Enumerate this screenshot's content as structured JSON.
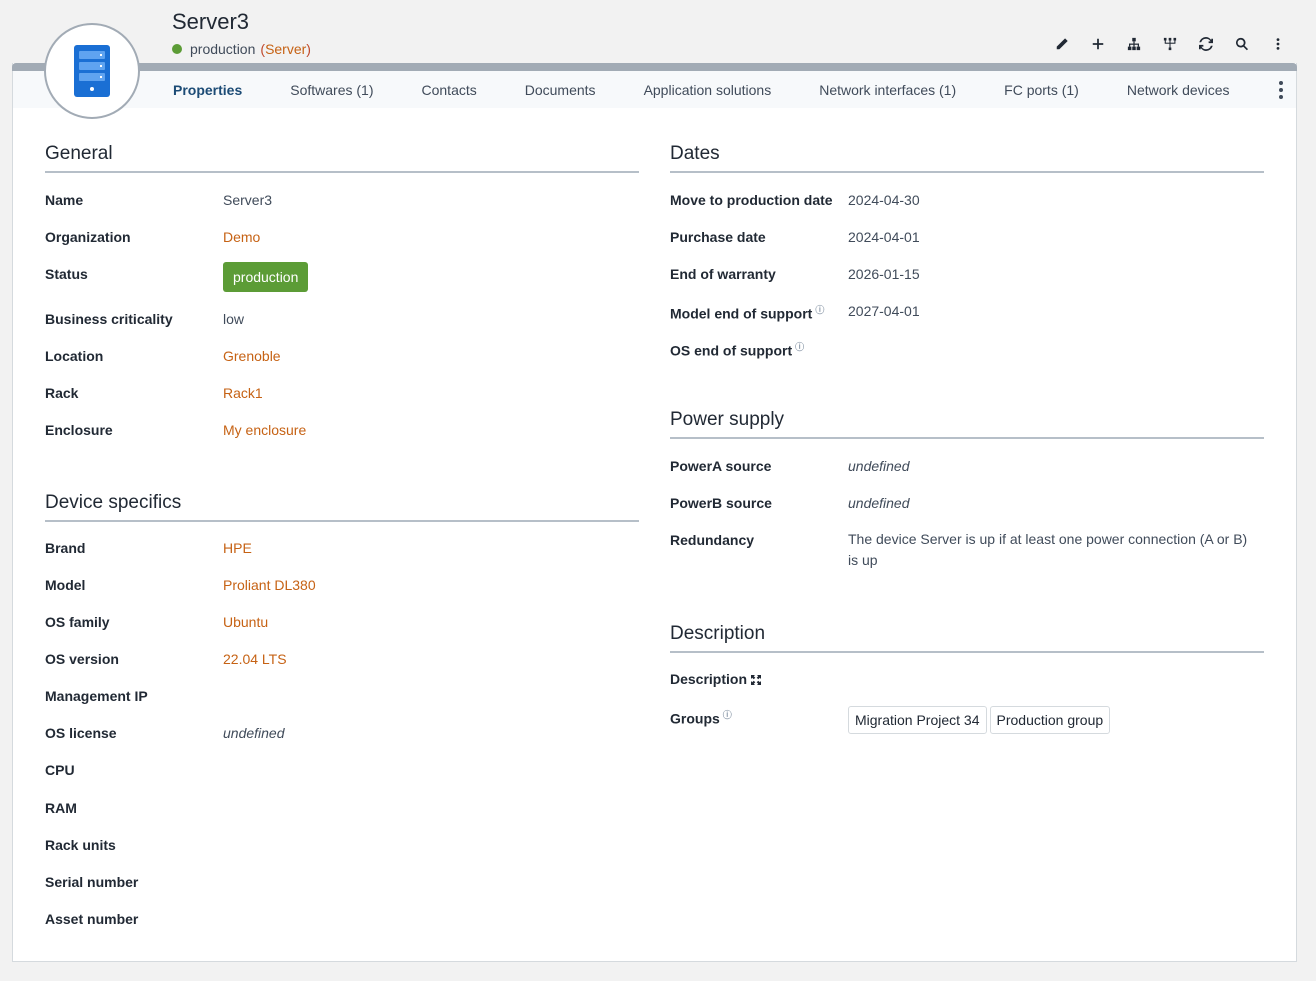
{
  "header": {
    "title": "Server3",
    "status": "production",
    "class_label": "Server",
    "toolbar": [
      "edit-icon",
      "add-icon",
      "hierarchy-icon",
      "network-icon",
      "refresh-icon",
      "search-icon",
      "more-icon"
    ]
  },
  "tabs": [
    {
      "label": "Properties",
      "active": true
    },
    {
      "label": "Softwares (1)"
    },
    {
      "label": "Contacts"
    },
    {
      "label": "Documents"
    },
    {
      "label": "Application solutions"
    },
    {
      "label": "Network interfaces (1)"
    },
    {
      "label": "FC ports (1)"
    },
    {
      "label": "Network devices"
    }
  ],
  "general": {
    "title": "General",
    "fields": {
      "name": {
        "label": "Name",
        "value": "Server3"
      },
      "organization": {
        "label": "Organization",
        "value": "Demo"
      },
      "status": {
        "label": "Status",
        "value": "production"
      },
      "business_criticality": {
        "label": "Business criticality",
        "value": "low"
      },
      "location": {
        "label": "Location",
        "value": "Grenoble"
      },
      "rack": {
        "label": "Rack",
        "value": "Rack1"
      },
      "enclosure": {
        "label": "Enclosure",
        "value": "My enclosure"
      }
    }
  },
  "device": {
    "title": "Device specifics",
    "fields": {
      "brand": {
        "label": "Brand",
        "value": "HPE"
      },
      "model": {
        "label": "Model",
        "value": "Proliant DL380"
      },
      "os_family": {
        "label": "OS family",
        "value": "Ubuntu"
      },
      "os_version": {
        "label": "OS version",
        "value": "22.04 LTS"
      },
      "management_ip": {
        "label": "Management IP",
        "value": ""
      },
      "os_license": {
        "label": "OS license",
        "value": "undefined"
      },
      "cpu": {
        "label": "CPU",
        "value": ""
      },
      "ram": {
        "label": "RAM",
        "value": ""
      },
      "rack_units": {
        "label": "Rack units",
        "value": ""
      },
      "serial_number": {
        "label": "Serial number",
        "value": ""
      },
      "asset_number": {
        "label": "Asset number",
        "value": ""
      }
    }
  },
  "dates": {
    "title": "Dates",
    "fields": {
      "move_to_production": {
        "label": "Move to production date",
        "value": "2024-04-30"
      },
      "purchase_date": {
        "label": "Purchase date",
        "value": "2024-04-01"
      },
      "end_of_warranty": {
        "label": "End of warranty",
        "value": "2026-01-15"
      },
      "model_end_of_support": {
        "label": "Model end of support",
        "value": "2027-04-01"
      },
      "os_end_of_support": {
        "label": "OS end of support",
        "value": ""
      }
    }
  },
  "power": {
    "title": "Power supply",
    "fields": {
      "powera": {
        "label": "PowerA source",
        "value": "undefined"
      },
      "powerb": {
        "label": "PowerB source",
        "value": "undefined"
      },
      "redundancy": {
        "label": "Redundancy",
        "value": "The device Server is up if at least one power connection (A or B) is up"
      }
    }
  },
  "description": {
    "title": "Description",
    "fields": {
      "description": {
        "label": "Description",
        "value": ""
      },
      "groups": {
        "label": "Groups",
        "values": [
          "Migration Project 34",
          "Production group"
        ]
      }
    }
  },
  "colors": {
    "status_green": "#5c9c36",
    "link_orange": "#c66214",
    "accent_blue": "#1c4b75",
    "server_icon_blue": "#1a6fd4"
  }
}
